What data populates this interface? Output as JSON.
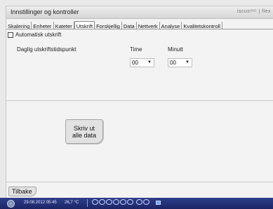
{
  "window": {
    "title": "Innstillinger og kontroller",
    "logo_text": "iscusᵐᵉᵗ | flex"
  },
  "tabs": [
    {
      "label": "Skalering",
      "active": false
    },
    {
      "label": "Enheter",
      "active": false
    },
    {
      "label": "Kateter",
      "active": false
    },
    {
      "label": "Utskrift",
      "active": true
    },
    {
      "label": "Forskjellig",
      "active": false
    },
    {
      "label": "Data",
      "active": false
    },
    {
      "label": "Nettverk",
      "active": false
    },
    {
      "label": "Analyse",
      "active": false
    },
    {
      "label": "Kvalitetskontroll",
      "active": false
    }
  ],
  "print": {
    "auto_print_label": "Automatisk utskrift",
    "auto_print_checked": false,
    "daily_time_label": "Daglig utskriftstidspunkt",
    "hour_label": "Time",
    "minute_label": "Minutt",
    "hour_value": "00",
    "minute_value": "00",
    "print_all_line1": "Skriv ut",
    "print_all_line2": "alle data"
  },
  "footer": {
    "back_label": "Tilbake"
  },
  "statusbar": {
    "datetime": "29.08.2012 05:45",
    "temperature": "26,7 °C"
  }
}
